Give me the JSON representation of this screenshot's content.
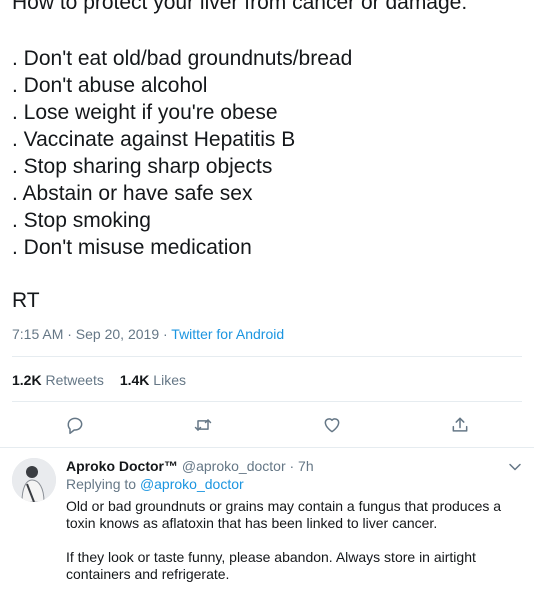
{
  "tweet": {
    "headline": "How to protect your liver from cancer or damage:",
    "lines": [
      ". Don't eat old/bad groundnuts/bread",
      ". Don't abuse alcohol",
      ". Lose weight if you're obese",
      ". Vaccinate against Hepatitis B",
      ". Stop sharing sharp objects",
      ". Abstain or have safe sex",
      ". Stop smoking",
      ". Don't misuse medication"
    ],
    "rt": "RT",
    "time": "7:15 AM · Sep 20, 2019 · ",
    "source": "Twitter for Android",
    "retweets_count": "1.2K",
    "retweets_label": "Retweets",
    "likes_count": "1.4K",
    "likes_label": "Likes"
  },
  "actions": {
    "icons": [
      "reply-icon",
      "retweet-icon",
      "like-icon",
      "share-icon"
    ],
    "accent": "#657786"
  },
  "reply": {
    "name": "Aproko Doctor™",
    "handle": "@aproko_doctor · 7h",
    "replying_prefix": "Replying to ",
    "replying_to": "@aproko_doctor",
    "paragraph1": "Old or bad groundnuts or grains may contain a fungus that produces a toxin knows as aflatoxin that has been linked to liver cancer.",
    "paragraph2": "If they look or taste funny, please abandon. Always store in airtight containers and refrigerate."
  },
  "colors": {
    "link": "#1b95e0",
    "muted": "#657786",
    "text": "#14171a"
  }
}
